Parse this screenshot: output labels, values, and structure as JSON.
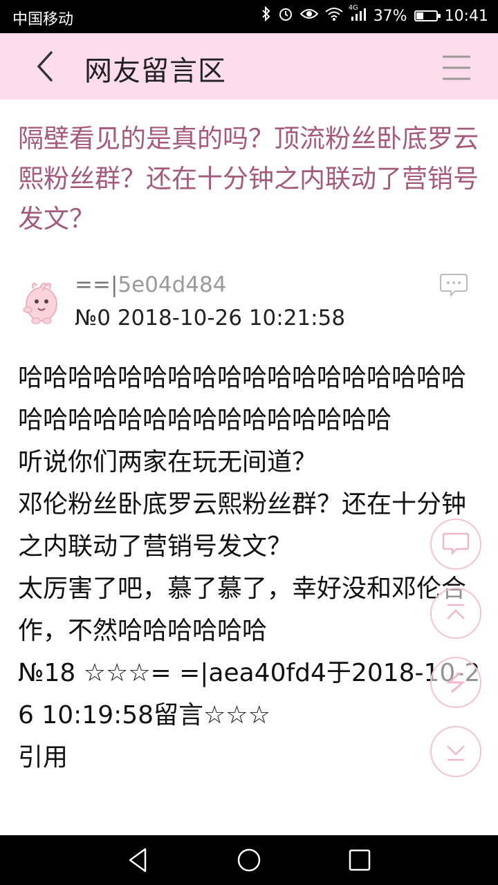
{
  "status_bar": {
    "carrier": "中国移动",
    "network": "4G",
    "battery": "37%",
    "battery_level": 0.37,
    "time": "10:41"
  },
  "header": {
    "title": "网友留言区",
    "back_icon": "chevron-left-icon",
    "menu_icon": "hamburger-menu-icon",
    "bg_color": "#fddde9"
  },
  "post": {
    "title": "隔壁看见的是真的吗？顶流粉丝卧底罗云熙粉丝群？还在十分钟之内联动了营销号发文？",
    "title_color": "#a45a7c",
    "author_prefix": "==|",
    "author_id": "5e04d484",
    "meta": "№0  2018-10-26 10:21:58",
    "body": [
      "哈哈哈哈哈哈哈哈哈哈哈哈哈哈哈哈哈哈哈哈哈哈哈哈哈哈哈哈哈哈哈哈哈",
      "听说你们两家在玩无间道？",
      "邓伦粉丝卧底罗云熙粉丝群？还在十分钟之内联动了营销号发文？",
      "太厉害了吧，慕了慕了，幸好没和邓伦合作，不然哈哈哈哈哈哈",
      "№18 ☆☆☆= =|aea40fd4于2018-10-26 10:19:58留言☆☆☆",
      "引用"
    ]
  },
  "fabs": [
    {
      "icon": "comment-icon"
    },
    {
      "icon": "arrow-up-top-icon"
    },
    {
      "icon": "refresh-icon"
    },
    {
      "icon": "arrow-down-bottom-icon"
    }
  ],
  "navbar": {
    "back_icon": "triangle-back-icon",
    "home_icon": "circle-home-icon",
    "recents_icon": "square-recents-icon"
  }
}
